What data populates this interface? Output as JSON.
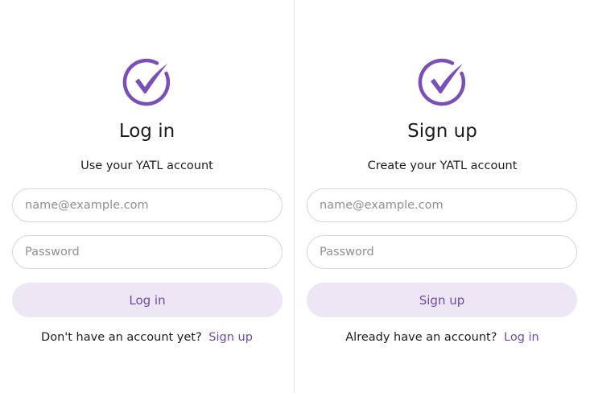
{
  "brand": {
    "accent": "#7b4fb8",
    "button_bg": "#ece6f5",
    "link": "#6f4aa8"
  },
  "login": {
    "logo_icon": "check-circle-icon",
    "title": "Log in",
    "subtitle": "Use your YATL account",
    "email_placeholder": "name@example.com",
    "password_placeholder": "Password",
    "submit_label": "Log in",
    "footer_text": "Don't have an account yet?",
    "footer_link": "Sign up"
  },
  "signup": {
    "logo_icon": "check-circle-icon",
    "title": "Sign up",
    "subtitle": "Create your YATL account",
    "email_placeholder": "name@example.com",
    "password_placeholder": "Password",
    "submit_label": "Sign up",
    "footer_text": "Already have an account?",
    "footer_link": "Log in"
  }
}
